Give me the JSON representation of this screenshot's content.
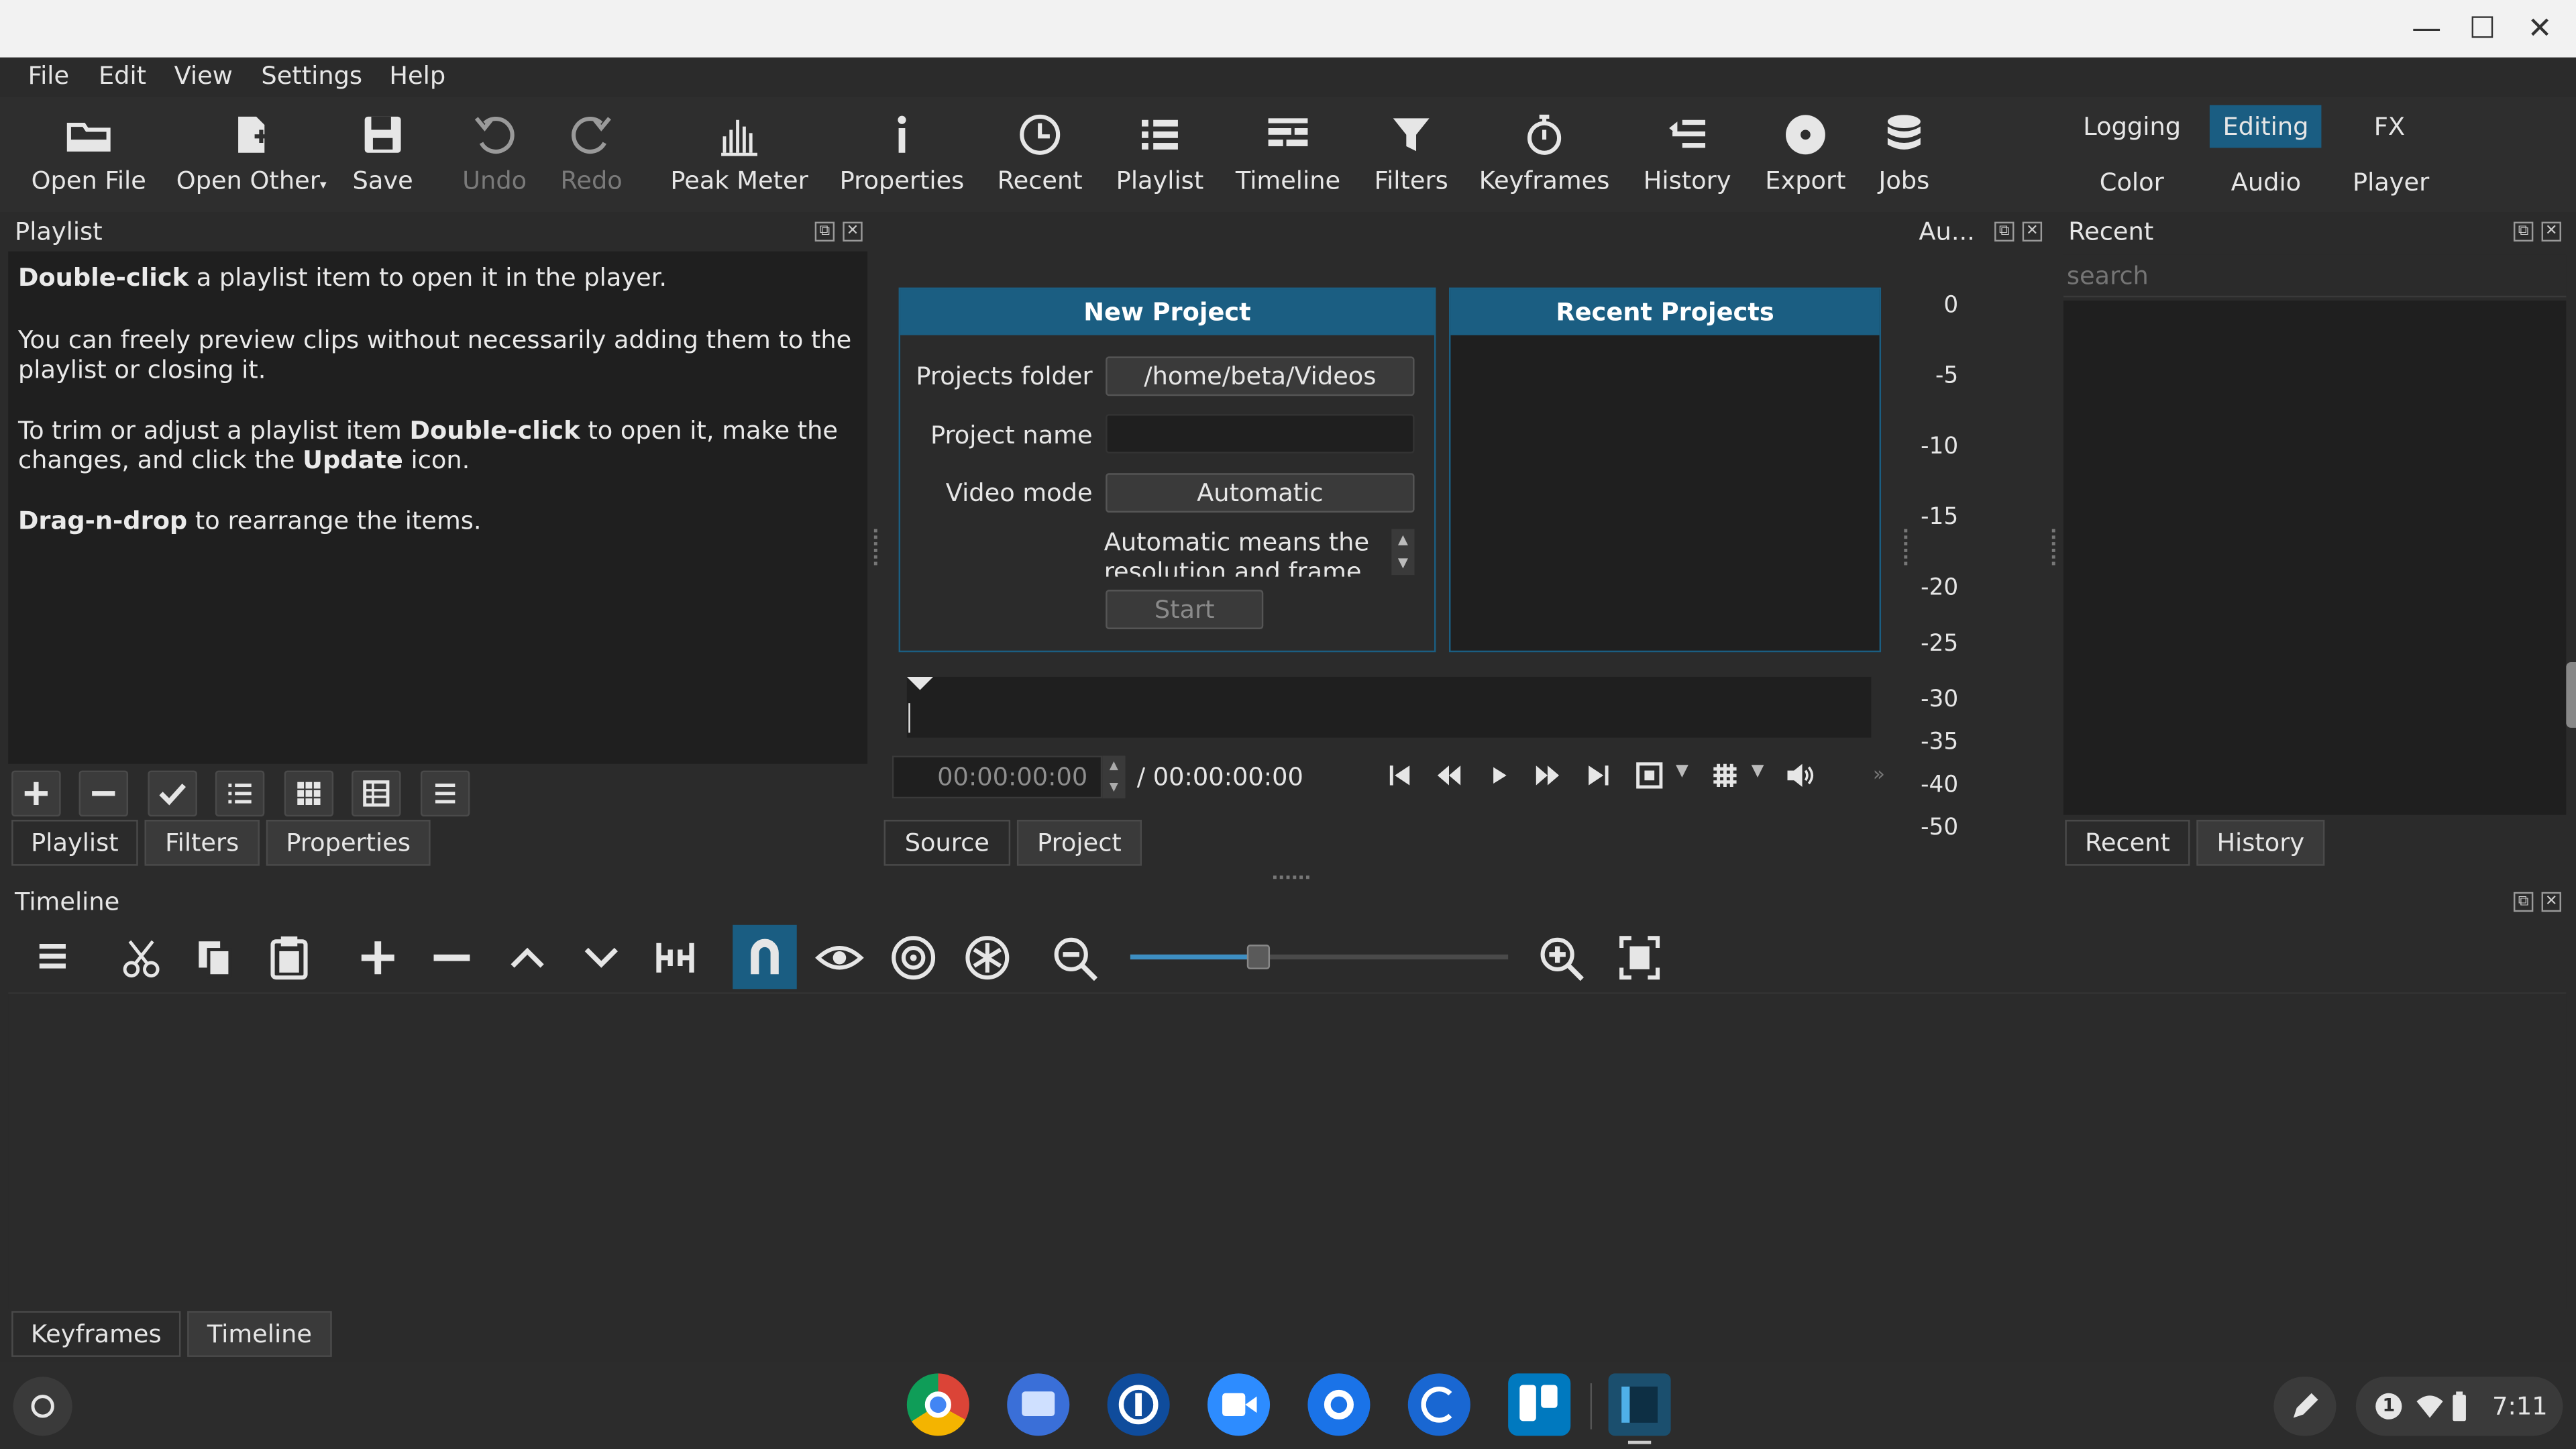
{
  "window": {
    "minimize": "—",
    "maximize": "☐",
    "close": "✕"
  },
  "menu": [
    "File",
    "Edit",
    "View",
    "Settings",
    "Help"
  ],
  "toolbar": {
    "open_file": "Open File",
    "open_other": "Open Other",
    "save": "Save",
    "undo": "Undo",
    "redo": "Redo",
    "peak_meter": "Peak Meter",
    "properties": "Properties",
    "recent": "Recent",
    "playlist": "Playlist",
    "timeline": "Timeline",
    "filters": "Filters",
    "keyframes": "Keyframes",
    "history": "History",
    "export": "Export",
    "jobs": "Jobs"
  },
  "workspaces": {
    "logging": "Logging",
    "editing": "Editing",
    "fx": "FX",
    "color": "Color",
    "audio": "Audio",
    "player": "Player"
  },
  "playlist": {
    "title": "Playlist",
    "help": {
      "p1_bold": "Double-click",
      "p1_rest": " a playlist item to open it in the player.",
      "p2": "You can freely preview clips without necessarily adding them to the playlist or closing it.",
      "p3_a": "To trim or adjust a playlist item ",
      "p3_b": "Double-click",
      "p3_c": " to open it, make the changes, and click the ",
      "p3_d": "Update",
      "p3_e": " icon.",
      "p4_bold": "Drag-n-drop",
      "p4_rest": " to rearrange the items."
    },
    "tabs": [
      "Playlist",
      "Filters",
      "Properties"
    ]
  },
  "new_project": {
    "title": "New Project",
    "projects_folder_label": "Projects folder",
    "projects_folder_value": "/home/beta/Videos",
    "project_name_label": "Project name",
    "project_name_value": "",
    "video_mode_label": "Video mode",
    "video_mode_value": "Automatic",
    "auto_note_1": "Automatic means the",
    "auto_note_2": "resolution and frame",
    "start": "Start"
  },
  "recent_projects": {
    "title": "Recent Projects"
  },
  "player": {
    "timecode": "00:00:00:00",
    "duration": "/ 00:00:00:00",
    "tabs": [
      "Source",
      "Project"
    ]
  },
  "audio_meter": {
    "title": "Au...",
    "scale": [
      "0",
      "-5",
      "-10",
      "-15",
      "-20",
      "-25",
      "-30",
      "-35",
      "-40",
      "-50"
    ]
  },
  "recent": {
    "title": "Recent",
    "search_placeholder": "search",
    "tabs": [
      "Recent",
      "History"
    ]
  },
  "timeline": {
    "title": "Timeline",
    "zoom": 0.34,
    "tabs": [
      "Keyframes",
      "Timeline"
    ]
  },
  "taskbar": {
    "time": "7:11",
    "notification_count": "1"
  }
}
